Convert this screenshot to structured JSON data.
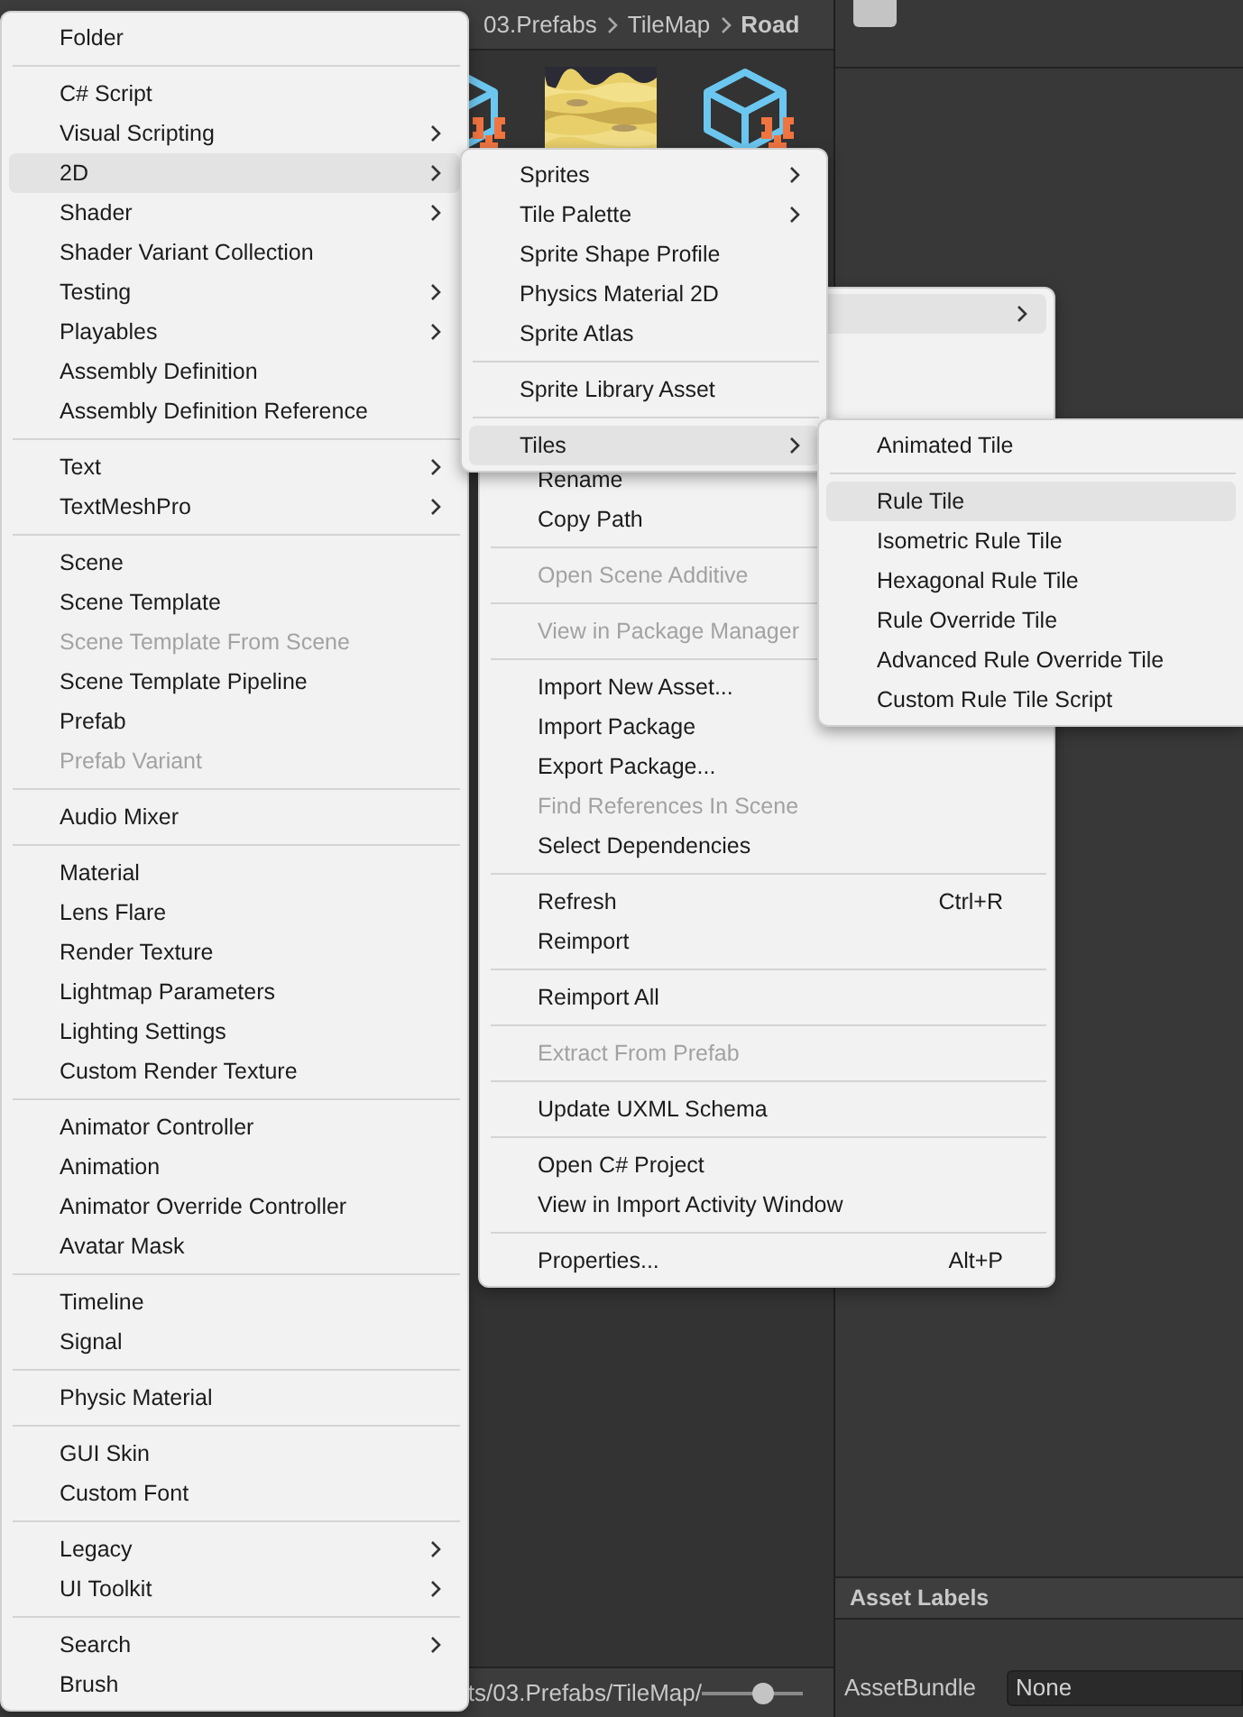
{
  "project": {
    "breadcrumb": [
      "03.Prefabs",
      "TileMap",
      "Road"
    ],
    "assets": [
      {
        "kind": "script"
      },
      {
        "kind": "picture"
      },
      {
        "kind": "script"
      }
    ],
    "footer_path": "ts/03.Prefabs/TileMap/",
    "zoom_slider": {
      "level": 0.6
    }
  },
  "inspector": {
    "section_title": "Asset Labels",
    "asset_bundle": {
      "label": "AssetBundle",
      "value": "None"
    }
  },
  "create_menu": {
    "items": [
      {
        "label": "Folder",
        "submenu": false,
        "selected": false,
        "disabled": false
      },
      {
        "kind": "separator"
      },
      {
        "label": "C# Script",
        "submenu": false,
        "selected": false,
        "disabled": false
      },
      {
        "label": "Visual Scripting",
        "submenu": true,
        "selected": false,
        "disabled": false
      },
      {
        "label": "2D",
        "submenu": true,
        "selected": true,
        "disabled": false
      },
      {
        "label": "Shader",
        "submenu": true,
        "selected": false,
        "disabled": false
      },
      {
        "label": "Shader Variant Collection",
        "submenu": false,
        "selected": false,
        "disabled": false
      },
      {
        "label": "Testing",
        "submenu": true,
        "selected": false,
        "disabled": false
      },
      {
        "label": "Playables",
        "submenu": true,
        "selected": false,
        "disabled": false
      },
      {
        "label": "Assembly Definition",
        "submenu": false,
        "selected": false,
        "disabled": false
      },
      {
        "label": "Assembly Definition Reference",
        "submenu": false,
        "selected": false,
        "disabled": false
      },
      {
        "kind": "separator"
      },
      {
        "label": "Text",
        "submenu": true,
        "selected": false,
        "disabled": false
      },
      {
        "label": "TextMeshPro",
        "submenu": true,
        "selected": false,
        "disabled": false
      },
      {
        "kind": "separator"
      },
      {
        "label": "Scene",
        "submenu": false,
        "selected": false,
        "disabled": false
      },
      {
        "label": "Scene Template",
        "submenu": false,
        "selected": false,
        "disabled": false
      },
      {
        "label": "Scene Template From Scene",
        "submenu": false,
        "selected": false,
        "disabled": true
      },
      {
        "label": "Scene Template Pipeline",
        "submenu": false,
        "selected": false,
        "disabled": false
      },
      {
        "label": "Prefab",
        "submenu": false,
        "selected": false,
        "disabled": false
      },
      {
        "label": "Prefab Variant",
        "submenu": false,
        "selected": false,
        "disabled": true
      },
      {
        "kind": "separator"
      },
      {
        "label": "Audio Mixer",
        "submenu": false,
        "selected": false,
        "disabled": false
      },
      {
        "kind": "separator"
      },
      {
        "label": "Material",
        "submenu": false,
        "selected": false,
        "disabled": false
      },
      {
        "label": "Lens Flare",
        "submenu": false,
        "selected": false,
        "disabled": false
      },
      {
        "label": "Render Texture",
        "submenu": false,
        "selected": false,
        "disabled": false
      },
      {
        "label": "Lightmap Parameters",
        "submenu": false,
        "selected": false,
        "disabled": false
      },
      {
        "label": "Lighting Settings",
        "submenu": false,
        "selected": false,
        "disabled": false
      },
      {
        "label": "Custom Render Texture",
        "submenu": false,
        "selected": false,
        "disabled": false
      },
      {
        "kind": "separator"
      },
      {
        "label": "Animator Controller",
        "submenu": false,
        "selected": false,
        "disabled": false
      },
      {
        "label": "Animation",
        "submenu": false,
        "selected": false,
        "disabled": false
      },
      {
        "label": "Animator Override Controller",
        "submenu": false,
        "selected": false,
        "disabled": false
      },
      {
        "label": "Avatar Mask",
        "submenu": false,
        "selected": false,
        "disabled": false
      },
      {
        "kind": "separator"
      },
      {
        "label": "Timeline",
        "submenu": false,
        "selected": false,
        "disabled": false
      },
      {
        "label": "Signal",
        "submenu": false,
        "selected": false,
        "disabled": false
      },
      {
        "kind": "separator"
      },
      {
        "label": "Physic Material",
        "submenu": false,
        "selected": false,
        "disabled": false
      },
      {
        "kind": "separator"
      },
      {
        "label": "GUI Skin",
        "submenu": false,
        "selected": false,
        "disabled": false
      },
      {
        "label": "Custom Font",
        "submenu": false,
        "selected": false,
        "disabled": false
      },
      {
        "kind": "separator"
      },
      {
        "label": "Legacy",
        "submenu": true,
        "selected": false,
        "disabled": false
      },
      {
        "label": "UI Toolkit",
        "submenu": true,
        "selected": false,
        "disabled": false
      },
      {
        "kind": "separator"
      },
      {
        "label": "Search",
        "submenu": true,
        "selected": false,
        "disabled": false
      },
      {
        "label": "Brush",
        "submenu": false,
        "selected": false,
        "disabled": false
      }
    ]
  },
  "context_menu": {
    "top_row": {
      "submenu": true,
      "selected": true
    },
    "items": [
      {
        "label": "Rename",
        "submenu": false,
        "selected": false,
        "disabled": false
      },
      {
        "label": "Copy Path",
        "submenu": false,
        "selected": false,
        "disabled": false
      },
      {
        "kind": "separator"
      },
      {
        "label": "Open Scene Additive",
        "submenu": false,
        "selected": false,
        "disabled": true
      },
      {
        "kind": "separator"
      },
      {
        "label": "View in Package Manager",
        "submenu": false,
        "selected": false,
        "disabled": true
      },
      {
        "kind": "separator"
      },
      {
        "label": "Import New Asset...",
        "submenu": false,
        "selected": false,
        "disabled": false
      },
      {
        "label": "Import Package",
        "submenu": false,
        "selected": false,
        "disabled": false
      },
      {
        "label": "Export Package...",
        "submenu": false,
        "selected": false,
        "disabled": false
      },
      {
        "label": "Find References In Scene",
        "submenu": false,
        "selected": false,
        "disabled": true
      },
      {
        "label": "Select Dependencies",
        "submenu": false,
        "selected": false,
        "disabled": false
      },
      {
        "kind": "separator"
      },
      {
        "label": "Refresh",
        "shortcut": "Ctrl+R",
        "submenu": false,
        "selected": false,
        "disabled": false
      },
      {
        "label": "Reimport",
        "submenu": false,
        "selected": false,
        "disabled": false
      },
      {
        "kind": "separator"
      },
      {
        "label": "Reimport All",
        "submenu": false,
        "selected": false,
        "disabled": false
      },
      {
        "kind": "separator"
      },
      {
        "label": "Extract From Prefab",
        "submenu": false,
        "selected": false,
        "disabled": true
      },
      {
        "kind": "separator"
      },
      {
        "label": "Update UXML Schema",
        "submenu": false,
        "selected": false,
        "disabled": false
      },
      {
        "kind": "separator"
      },
      {
        "label": "Open C# Project",
        "submenu": false,
        "selected": false,
        "disabled": false
      },
      {
        "label": "View in Import Activity Window",
        "submenu": false,
        "selected": false,
        "disabled": false
      },
      {
        "kind": "separator"
      },
      {
        "label": "Properties...",
        "shortcut": "Alt+P",
        "submenu": false,
        "selected": false,
        "disabled": false
      }
    ]
  },
  "submenu_2d": {
    "items": [
      {
        "label": "Sprites",
        "submenu": true,
        "selected": false,
        "disabled": false
      },
      {
        "label": "Tile Palette",
        "submenu": true,
        "selected": false,
        "disabled": false
      },
      {
        "label": "Sprite Shape Profile",
        "submenu": false,
        "selected": false,
        "disabled": false
      },
      {
        "label": "Physics Material 2D",
        "submenu": false,
        "selected": false,
        "disabled": false
      },
      {
        "label": "Sprite Atlas",
        "submenu": false,
        "selected": false,
        "disabled": false
      },
      {
        "kind": "separator"
      },
      {
        "label": "Sprite Library Asset",
        "submenu": false,
        "selected": false,
        "disabled": false
      },
      {
        "kind": "separator"
      },
      {
        "label": "Tiles",
        "submenu": true,
        "selected": true,
        "disabled": false
      }
    ]
  },
  "submenu_tiles": {
    "items": [
      {
        "label": "Animated Tile",
        "submenu": false,
        "selected": false,
        "disabled": false
      },
      {
        "kind": "separator"
      },
      {
        "label": "Rule Tile",
        "submenu": false,
        "selected": true,
        "disabled": false
      },
      {
        "label": "Isometric Rule Tile",
        "submenu": false,
        "selected": false,
        "disabled": false
      },
      {
        "label": "Hexagonal Rule Tile",
        "submenu": false,
        "selected": false,
        "disabled": false
      },
      {
        "label": "Rule Override Tile",
        "submenu": false,
        "selected": false,
        "disabled": false
      },
      {
        "label": "Advanced Rule Override Tile",
        "submenu": false,
        "selected": false,
        "disabled": false
      },
      {
        "label": "Custom Rule Tile Script",
        "submenu": false,
        "selected": false,
        "disabled": false
      }
    ]
  }
}
